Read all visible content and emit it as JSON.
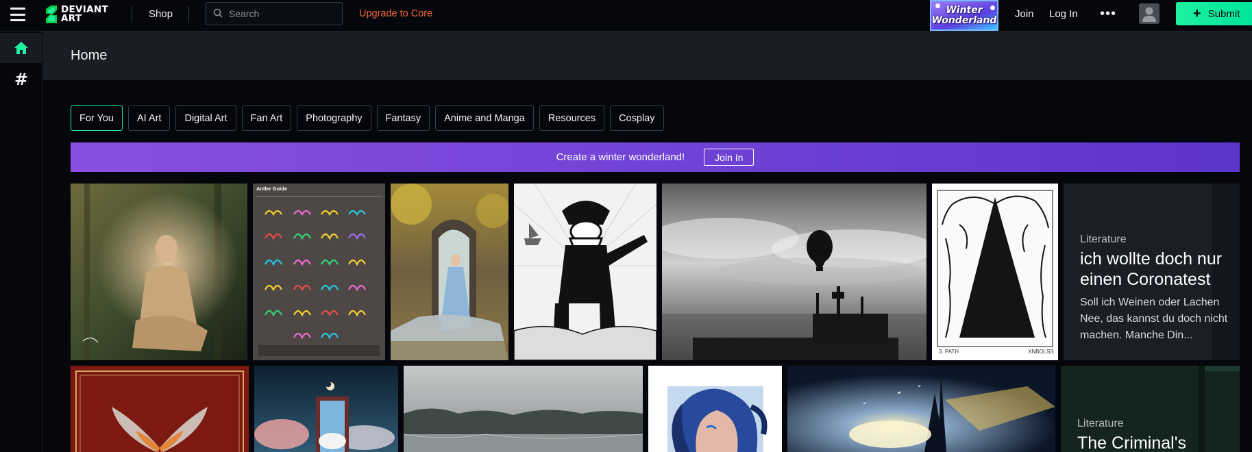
{
  "header": {
    "logo_text": "DEVIANT ART",
    "shop_label": "Shop",
    "search_placeholder": "Search",
    "upgrade_label": "Upgrade to Core",
    "promo_text": "Winter Wonderland",
    "join_label": "Join",
    "login_label": "Log In",
    "more_label": "•••",
    "submit_label": "Submit"
  },
  "sidebar": {
    "items": [
      {
        "icon": "home-icon",
        "active": true
      },
      {
        "icon": "hashtag-icon",
        "active": false
      }
    ]
  },
  "page": {
    "title": "Home"
  },
  "categories": [
    "For You",
    "AI Art",
    "Digital Art",
    "Fan Art",
    "Photography",
    "Fantasy",
    "Anime and Manga",
    "Resources",
    "Cosplay"
  ],
  "selected_category": "For You",
  "banner": {
    "text": "Create a winter wonderland!",
    "button_label": "Join In"
  },
  "gallery": {
    "literature": [
      {
        "type": "Literature",
        "title": "ich wollte doch nur einen Coronatest",
        "excerpt": "Soll ich Weinen oder Lachen Nee, das kannst du doch nicht machen. Manche Din..."
      },
      {
        "type": "Literature",
        "title": "The Criminal's"
      }
    ],
    "image_captions": {
      "antler_guide_title": "Antler Guide",
      "tree_artwork_caption_left": "3. PATH",
      "tree_artwork_caption_right": "XNBOLSS"
    }
  },
  "colors": {
    "accent_green": "#1ef0a0",
    "upgrade_orange": "#f56c3b",
    "banner_purple": "#7143d6",
    "background": "#06070d"
  }
}
